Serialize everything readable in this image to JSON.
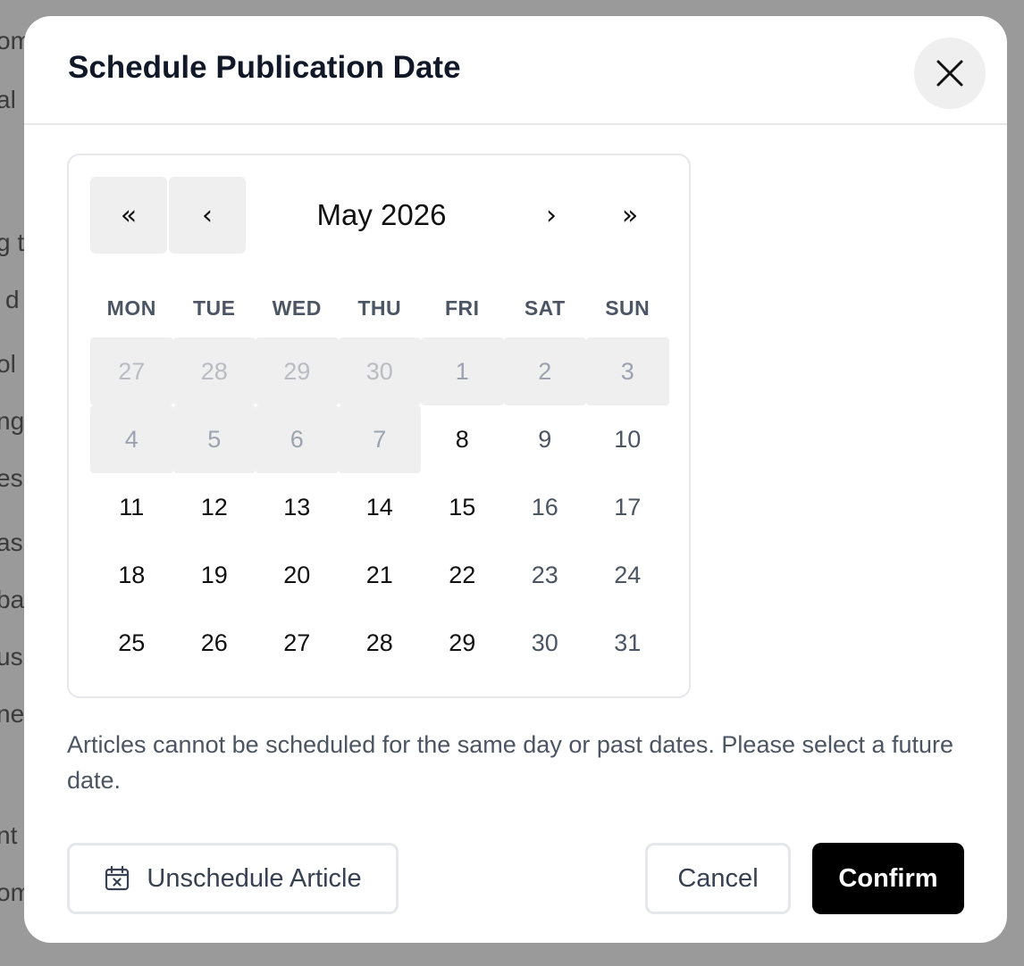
{
  "background_fragments": [
    "om",
    "al",
    "g t",
    "d",
    "ol",
    "ng",
    "es",
    "as",
    "ba",
    "us",
    "ne",
    "nt",
    "om"
  ],
  "dialog": {
    "title": "Schedule Publication Date",
    "close_icon": "close-icon"
  },
  "calendar": {
    "nav": {
      "prev_year": "«",
      "prev_month": "‹",
      "next_month": "›",
      "next_year": "»"
    },
    "month_label": "May 2026",
    "weekdays": [
      "MON",
      "TUE",
      "WED",
      "THU",
      "FRI",
      "SAT",
      "SUN"
    ],
    "days": [
      {
        "label": "27",
        "state": "disabled-other"
      },
      {
        "label": "28",
        "state": "disabled-other"
      },
      {
        "label": "29",
        "state": "disabled-other"
      },
      {
        "label": "30",
        "state": "disabled-other"
      },
      {
        "label": "1",
        "state": "disabled"
      },
      {
        "label": "2",
        "state": "disabled"
      },
      {
        "label": "3",
        "state": "disabled"
      },
      {
        "label": "4",
        "state": "disabled"
      },
      {
        "label": "5",
        "state": "disabled"
      },
      {
        "label": "6",
        "state": "disabled"
      },
      {
        "label": "7",
        "state": "disabled"
      },
      {
        "label": "8",
        "state": "available"
      },
      {
        "label": "9",
        "state": "weekend"
      },
      {
        "label": "10",
        "state": "weekend"
      },
      {
        "label": "11",
        "state": "available"
      },
      {
        "label": "12",
        "state": "available"
      },
      {
        "label": "13",
        "state": "available"
      },
      {
        "label": "14",
        "state": "available"
      },
      {
        "label": "15",
        "state": "available"
      },
      {
        "label": "16",
        "state": "weekend"
      },
      {
        "label": "17",
        "state": "weekend"
      },
      {
        "label": "18",
        "state": "available"
      },
      {
        "label": "19",
        "state": "available"
      },
      {
        "label": "20",
        "state": "available"
      },
      {
        "label": "21",
        "state": "available"
      },
      {
        "label": "22",
        "state": "available"
      },
      {
        "label": "23",
        "state": "weekend"
      },
      {
        "label": "24",
        "state": "weekend"
      },
      {
        "label": "25",
        "state": "available"
      },
      {
        "label": "26",
        "state": "available"
      },
      {
        "label": "27",
        "state": "available"
      },
      {
        "label": "28",
        "state": "available"
      },
      {
        "label": "29",
        "state": "available"
      },
      {
        "label": "30",
        "state": "weekend"
      },
      {
        "label": "31",
        "state": "weekend"
      }
    ]
  },
  "note": "Articles cannot be scheduled for the same day or past dates. Please select a future date.",
  "actions": {
    "unschedule_label": "Unschedule Article",
    "unschedule_icon": "calendar-x-icon",
    "cancel_label": "Cancel",
    "confirm_label": "Confirm"
  },
  "colors": {
    "confirm_bg": "#000000",
    "disabled_bg": "#efefef",
    "weekend_text": "#4b5563",
    "overlay": "#9a9a9a"
  }
}
